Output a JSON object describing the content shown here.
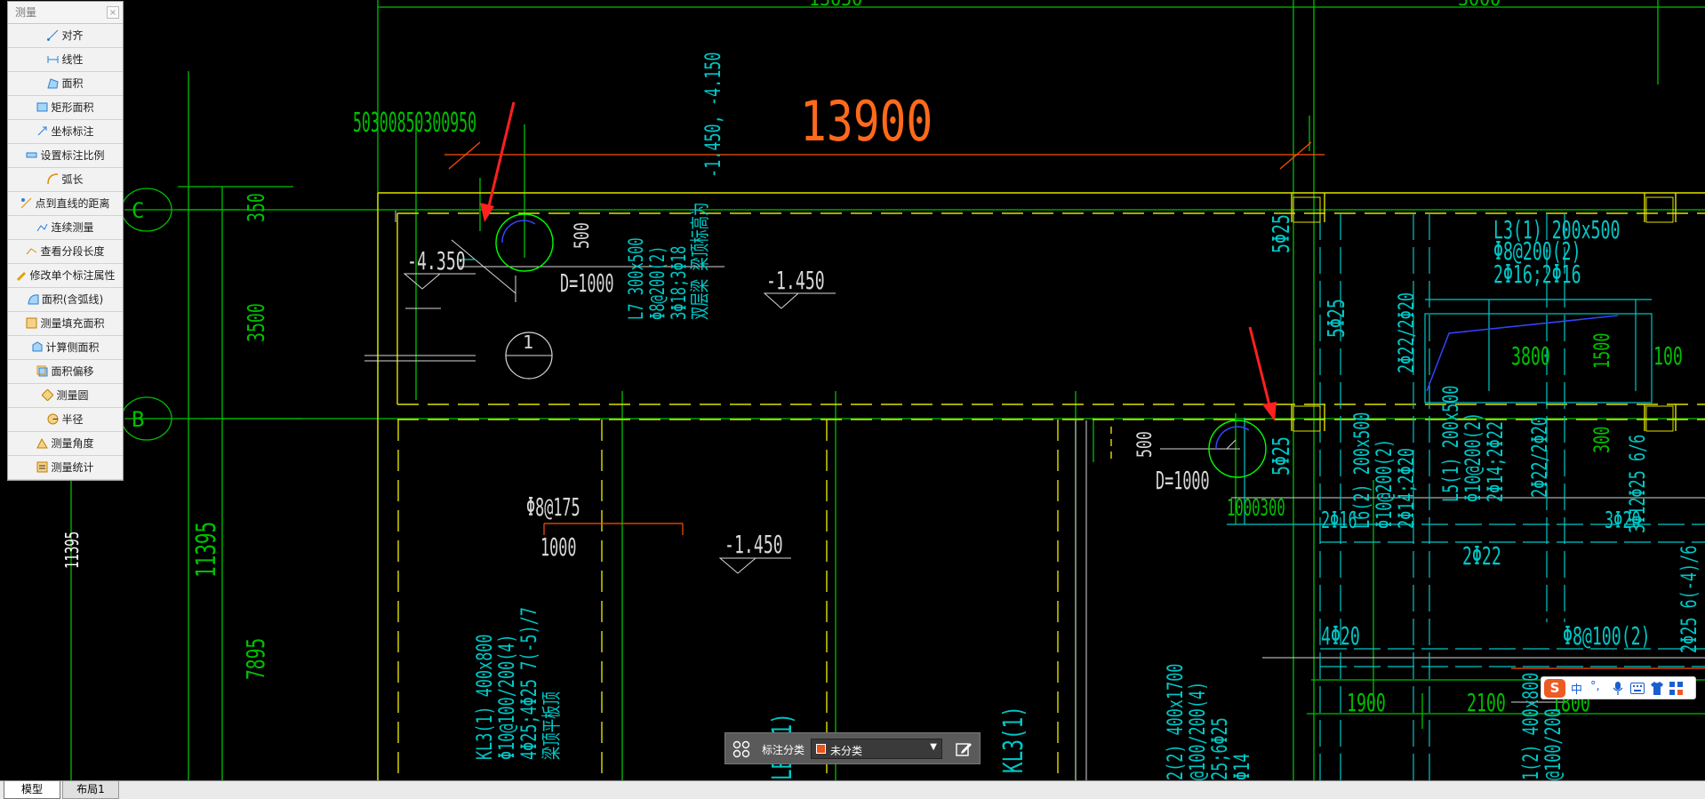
{
  "measure_panel": {
    "title": "测量",
    "close_label": "×",
    "items": [
      {
        "label": "对齐",
        "icon": "aligned-dimension-icon"
      },
      {
        "label": "线性",
        "icon": "linear-dimension-icon"
      },
      {
        "label": "面积",
        "icon": "area-icon"
      },
      {
        "label": "矩形面积",
        "icon": "rect-area-icon"
      },
      {
        "label": "坐标标注",
        "icon": "coordinate-icon"
      },
      {
        "label": "设置标注比例",
        "icon": "scale-icon"
      },
      {
        "label": "弧长",
        "icon": "arc-length-icon"
      },
      {
        "label": "点到直线的距离",
        "icon": "point-line-icon"
      },
      {
        "label": "连续测量",
        "icon": "continuous-measure-icon"
      },
      {
        "label": "查看分段长度",
        "icon": "segment-length-icon"
      },
      {
        "label": "修改单个标注属性",
        "icon": "edit-dimension-icon"
      },
      {
        "label": "面积(含弧线)",
        "icon": "arc-area-icon"
      },
      {
        "label": "测量填充面积",
        "icon": "hatch-area-icon"
      },
      {
        "label": "计算侧面积",
        "icon": "side-area-icon"
      },
      {
        "label": "面积偏移",
        "icon": "area-offset-icon"
      },
      {
        "label": "测量圆",
        "icon": "circle-measure-icon"
      },
      {
        "label": "半径",
        "icon": "radius-icon"
      },
      {
        "label": "测量角度",
        "icon": "angle-icon"
      },
      {
        "label": "测量统计",
        "icon": "statistics-icon"
      }
    ]
  },
  "drawing": {
    "top_dim_left": "13050",
    "top_dim_right": "3000",
    "big_dim": "13900",
    "small_dims_top": "50300850300950",
    "left_dim_350": "350",
    "left_dim_3500": "3500",
    "left_dim_11395_a": "11395",
    "left_dim_11395_b": "11395",
    "left_dim_7895": "7895",
    "axis_c": "C",
    "axis_b": "B",
    "elev_4350": "-4.350",
    "elev_1450_a": "-1.450",
    "elev_1450_b": "-1.450",
    "d1000_a": "D=1000",
    "d1000_b": "D=1000",
    "dim_500_a": "500",
    "dim_500_b": "500",
    "circle_mark": "1",
    "beam_l7": [
      "L7 300x500",
      "Φ8@200(2)",
      "3Φ18;3Φ18",
      "双层梁 梁顶标高为"
    ],
    "beam_elev_note": "-1.450, -4.150",
    "phi8_175": "Φ8@175",
    "dim_1000": "1000",
    "kl3_note": [
      "KL3(1) 400x800",
      "Φ10@100/200(4)",
      "4Φ25;4Φ25 7(-5)/7",
      "梁顶平板顶"
    ],
    "lb3_a": "LB3(1)",
    "kl3_b": "KL3(1)",
    "l5_25_a": "5Φ25",
    "l5_25_b": "5Φ25",
    "l5_25_c": "5Φ25",
    "l3_note": [
      "L3(1) 200x500",
      "Φ8@200(2)",
      "2Φ16;2Φ16"
    ],
    "l6_note": [
      "L6(2) 200x500",
      "Φ10@200(2)",
      "2Φ14;2Φ20"
    ],
    "l5_note": [
      "L5(1) 200x500",
      "Φ10@200(2)",
      "2Φ14;2Φ22"
    ],
    "dim_3800": "3800",
    "dim_1500": "1500",
    "dim_100": "100",
    "dim_300": "300",
    "dim_1000300": "1000300",
    "phi16": "2Φ16",
    "phi22_22": "2Φ22/2Φ20",
    "phi22_b": "2Φ22/2Φ20",
    "phi2_22": "2Φ22",
    "phi20_3": "3Φ20",
    "phi20_4": "4Φ20",
    "phi12_25": "3Φ12Φ25 6/6",
    "phi8_100": "Φ8@100(2)",
    "dim_1900": "1900",
    "dim_2100": "2100",
    "dim_1800": "1800",
    "l2_note": [
      "2(2) 400x1700",
      "@100/200(4)",
      "25;6Φ25",
      "Φ14"
    ],
    "l1_note": [
      "1(2) 400x800",
      "@100/200"
    ],
    "right_edge_note": "2Φ25 6(-4)/6"
  },
  "classify_bar": {
    "label": "标注分类",
    "selected": "未分类",
    "swatch_color": "#e8541a"
  },
  "ime": {
    "logo": "S",
    "mode": "中",
    "punct": "°,"
  },
  "tabs": {
    "model": "模型",
    "layout1": "布局1"
  }
}
